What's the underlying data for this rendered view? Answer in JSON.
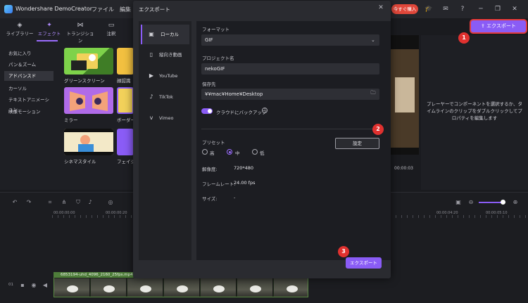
{
  "titlebar": {
    "app_title": "Wondershare DemoCreator",
    "menus": [
      "ファイル",
      "編集"
    ],
    "buy_label": "今すぐ購入"
  },
  "library_tabs": [
    {
      "label": "ライブラリー",
      "icon": "layers-icon"
    },
    {
      "label": "エフェクト",
      "icon": "effect-icon"
    },
    {
      "label": "トランジション",
      "icon": "transition-icon"
    },
    {
      "label": "注釈",
      "icon": "annotation-icon"
    }
  ],
  "categories": [
    "お気に入り",
    "パン＆ズーム",
    "アドバンスド",
    "カーソル",
    "テキストアニメーション",
    "映像モーション"
  ],
  "active_category": "アドバンスド",
  "thumbnails": [
    "グリーンスクリーン",
    "顔認識",
    "ミラー",
    "ボーダー",
    "シネマスタイル",
    "フェイシ"
  ],
  "header": {
    "export_label": "エクスポート"
  },
  "preview": {
    "hint": "プレーヤーでコンポーネントを選択するか、タイムラインのクリップをダブルクリックしてプロパティを編集します",
    "time": "00:00:03"
  },
  "badges": [
    "1",
    "2",
    "3"
  ],
  "dialog": {
    "title": "エクスポート",
    "side_items": [
      {
        "label": "ローカル",
        "icon": "local-icon"
      },
      {
        "label": "縦向き動画",
        "icon": "vertical-video-icon"
      },
      {
        "label": "YouTube",
        "icon": "youtube-icon"
      },
      {
        "label": "TikTok",
        "icon": "tiktok-icon"
      },
      {
        "label": "Vimeo",
        "icon": "vimeo-icon"
      }
    ],
    "format_label": "フォーマット",
    "format_value": "GIF",
    "project_label": "プロジェクト名",
    "project_value": "nekoGIF",
    "save_label": "保存先",
    "save_value": "¥¥mac¥Home¥Desktop",
    "cloud_label": "クラウドにバックアップ",
    "cloud_enabled": true,
    "preset_label": "プリセット",
    "presets": [
      "高",
      "中",
      "低"
    ],
    "preset_selected": "中",
    "settings_label": "設定",
    "resolution_label": "解像度:",
    "resolution_value": "720*480",
    "framerate_label": "フレームレート:",
    "framerate_value": "24.00 fps",
    "size_label": "サイズ:",
    "size_value": "-",
    "export_label": "エクスポート"
  },
  "timeline": {
    "ticks": [
      "00:00:00:00",
      "00:00:00:20",
      "00:00:04:20",
      "00:00:05:10"
    ],
    "track_number": "01",
    "clip_name": "6853194-uhd_4096_2160_25fps.mp4"
  }
}
